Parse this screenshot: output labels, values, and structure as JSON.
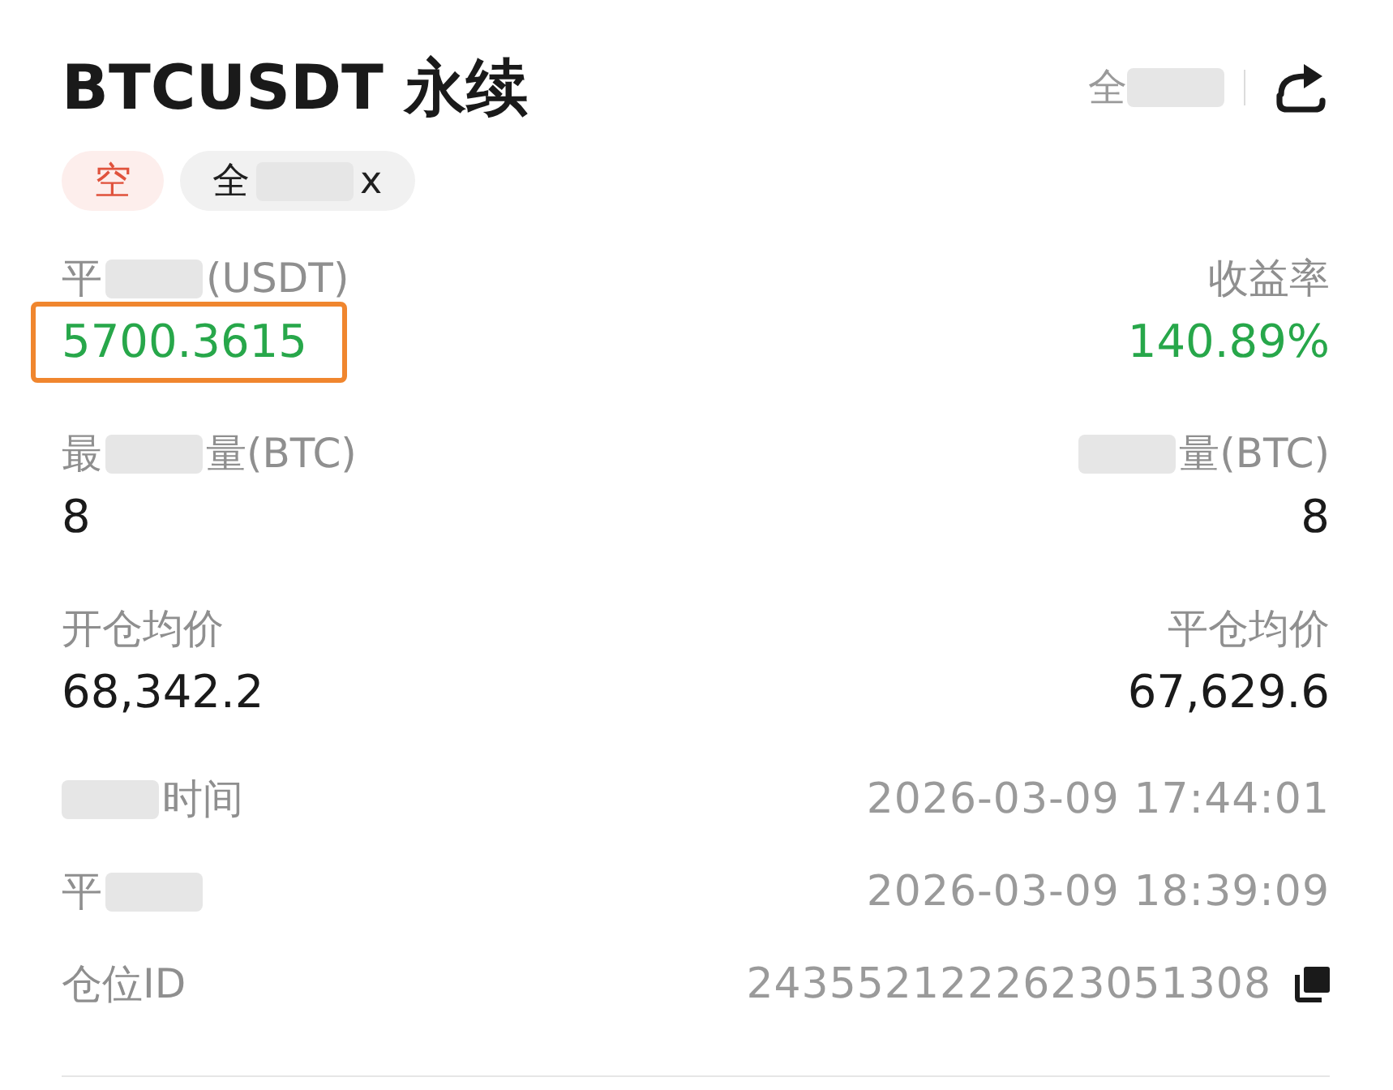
{
  "header": {
    "title": "BTCUSDT 永续",
    "filter": [
      {
        "kind": "text",
        "text": "全"
      },
      {
        "kind": "redacted"
      }
    ]
  },
  "tags": [
    {
      "kind": "side",
      "label": "空"
    },
    {
      "kind": "mode",
      "label": [
        {
          "kind": "text",
          "text": "全"
        },
        {
          "kind": "redacted"
        },
        {
          "kind": "text",
          "text": "x"
        }
      ]
    }
  ],
  "stats": [
    {
      "left": {
        "label": [
          {
            "kind": "text",
            "text": "平"
          },
          {
            "kind": "redacted"
          },
          {
            "kind": "text",
            "text": "(USDT)"
          }
        ],
        "value": "5700.3615",
        "color": "#27a74a",
        "highlighted": true
      },
      "right": {
        "label": "收益率",
        "value": "140.89%",
        "color": "#27a74a",
        "highlighted": false
      }
    },
    {
      "left": {
        "label": [
          {
            "kind": "text",
            "text": "最"
          },
          {
            "kind": "redacted"
          },
          {
            "kind": "text",
            "text": "量(BTC)"
          }
        ],
        "value": "8",
        "color": "#1a1a1a",
        "highlighted": false
      },
      "right": {
        "label": [
          {
            "kind": "redacted"
          },
          {
            "kind": "text",
            "text": "量(BTC)"
          }
        ],
        "value": "8",
        "color": "#1a1a1a",
        "highlighted": false
      }
    },
    {
      "left": {
        "label": "开仓均价",
        "value": "68,342.2",
        "color": "#1a1a1a",
        "highlighted": false
      },
      "right": {
        "label": "平仓均价",
        "value": "67,629.6",
        "color": "#1a1a1a",
        "highlighted": false
      }
    }
  ],
  "details": [
    {
      "label": [
        {
          "kind": "redacted"
        },
        {
          "kind": "text",
          "text": "时间"
        }
      ],
      "value": "2026-03-09 17:44:01",
      "copyable": false
    },
    {
      "label": [
        {
          "kind": "text",
          "text": "平"
        },
        {
          "kind": "redacted"
        }
      ],
      "value": "2026-03-09 18:39:09",
      "copyable": false
    },
    {
      "label": "仓位ID",
      "value": "2435521222623051308",
      "copyable": true
    }
  ]
}
